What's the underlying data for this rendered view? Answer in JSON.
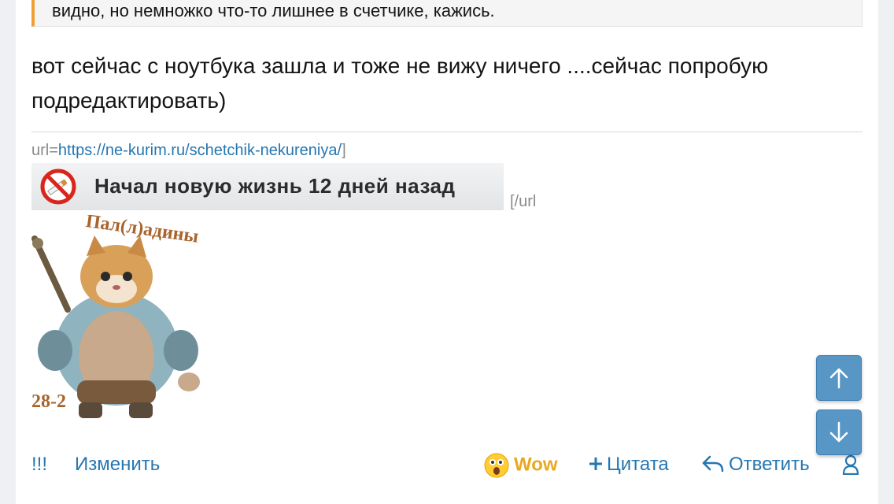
{
  "quote": {
    "text": "видно, но немножко что-то лишнее в счетчике, кажись."
  },
  "message": {
    "text": "вот сейчас с ноутбука зашла и тоже не вижу ничего ....сейчас попробую подредактировать)"
  },
  "signature": {
    "url_open": "url=",
    "link": "https://ne-kurim.ru/schetchik-nekureniya/",
    "bracket": "]",
    "counter_text": "Начал новую жизнь 12 дней назад",
    "url_close": "[/url",
    "avatar_caption": "Пал(л)адины",
    "avatar_number": "28-2"
  },
  "actions": {
    "bang": "!!!",
    "edit": "Изменить",
    "wow": "Wow",
    "quote": "Цитата",
    "reply": "Ответить"
  },
  "colors": {
    "link": "#2577b1",
    "quote_border": "#f19e35",
    "wow": "#e8a820",
    "scroll_button": "#5896c6"
  },
  "icons": {
    "counter": "no-smoking-icon",
    "wow": "astonished-emoji-icon",
    "quote": "plus-icon",
    "reply": "reply-arrow-icon",
    "user": "user-icon",
    "scroll_up": "arrow-up-icon",
    "scroll_down": "arrow-down-icon"
  }
}
